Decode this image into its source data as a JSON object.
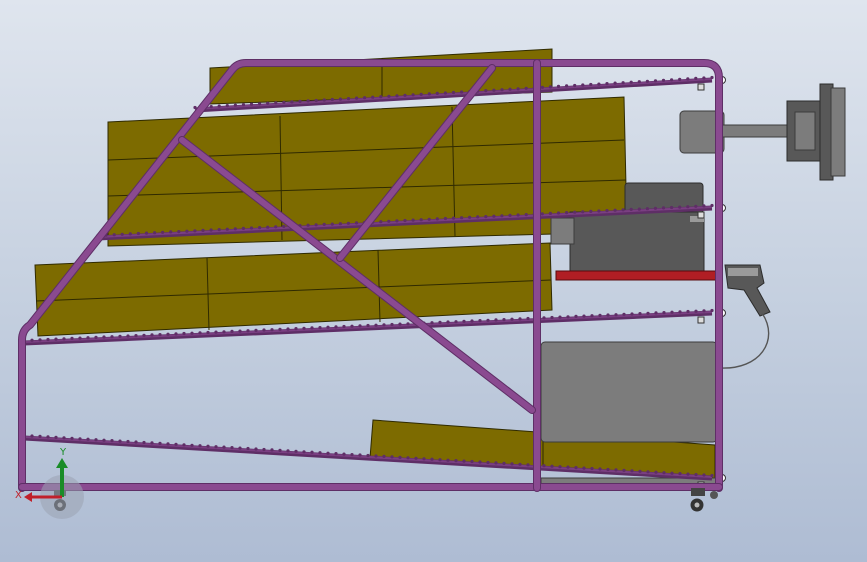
{
  "viewport": {
    "background_top": "#dfe5ee",
    "background_bottom": "#aebcd3"
  },
  "triad": {
    "x_label": "X",
    "y_label": "Y",
    "x_color": "#c0202a",
    "y_color": "#1a8c28",
    "z_color": "#2a3cc8"
  },
  "colors": {
    "frame": "#8a4a90",
    "frame_dark": "#5e2e66",
    "box_fill": "#7d6b00",
    "box_stroke": "#2f2a00",
    "roller": "#7a3f82",
    "accent_red": "#b01e24",
    "gray_panel": "#7c7c7c",
    "gray_dark": "#585858"
  },
  "model": {
    "parts": [
      "frame-tube-structure",
      "roller-shelf-top",
      "roller-shelf-second",
      "roller-shelf-third",
      "roller-shelf-bottom",
      "carton-stack",
      "monitor",
      "printer",
      "barcode-scanner",
      "cabinet",
      "casters"
    ]
  }
}
